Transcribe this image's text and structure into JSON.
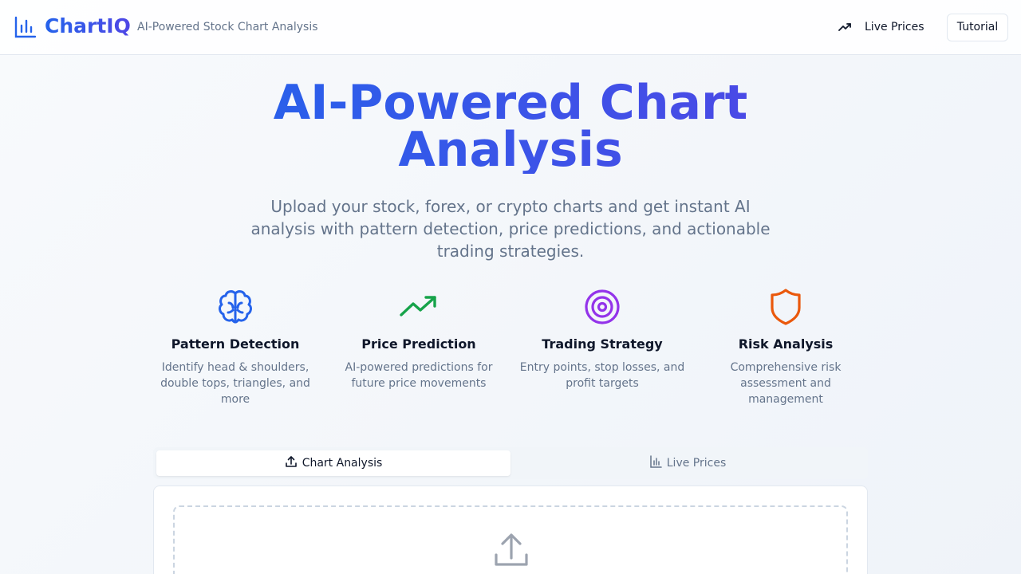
{
  "header": {
    "brand_name": "ChartIQ",
    "tagline": "AI-Powered Stock Chart Analysis",
    "live_prices_label": "Live Prices",
    "tutorial_label": "Tutorial",
    "brand_icon": "bar-chart-icon"
  },
  "hero": {
    "title": "AI-Powered Chart Analysis",
    "subtitle": "Upload your stock, forex, or crypto charts and get instant AI analysis with pattern detection, price predictions, and actionable trading strategies."
  },
  "features": [
    {
      "icon": "brain-icon",
      "color": "#2563eb",
      "title": "Pattern Detection",
      "description": "Identify head & shoulders, double tops, triangles, and more"
    },
    {
      "icon": "trending-up-icon",
      "color": "#16a34a",
      "title": "Price Prediction",
      "description": "AI-powered predictions for future price movements"
    },
    {
      "icon": "target-icon",
      "color": "#9333ea",
      "title": "Trading Strategy",
      "description": "Entry points, stop losses, and profit targets"
    },
    {
      "icon": "shield-icon",
      "color": "#ea580c",
      "title": "Risk Analysis",
      "description": "Comprehensive risk assessment and management"
    }
  ],
  "tabs": [
    {
      "label": "Chart Analysis",
      "icon": "upload-icon",
      "active": true
    },
    {
      "label": "Live Prices",
      "icon": "bar-chart-icon",
      "active": false
    }
  ],
  "upload": {
    "icon": "upload-icon"
  },
  "colors": {
    "brand": "#2563eb",
    "brand_end": "#4f46e5",
    "muted_text": "#64748b"
  }
}
